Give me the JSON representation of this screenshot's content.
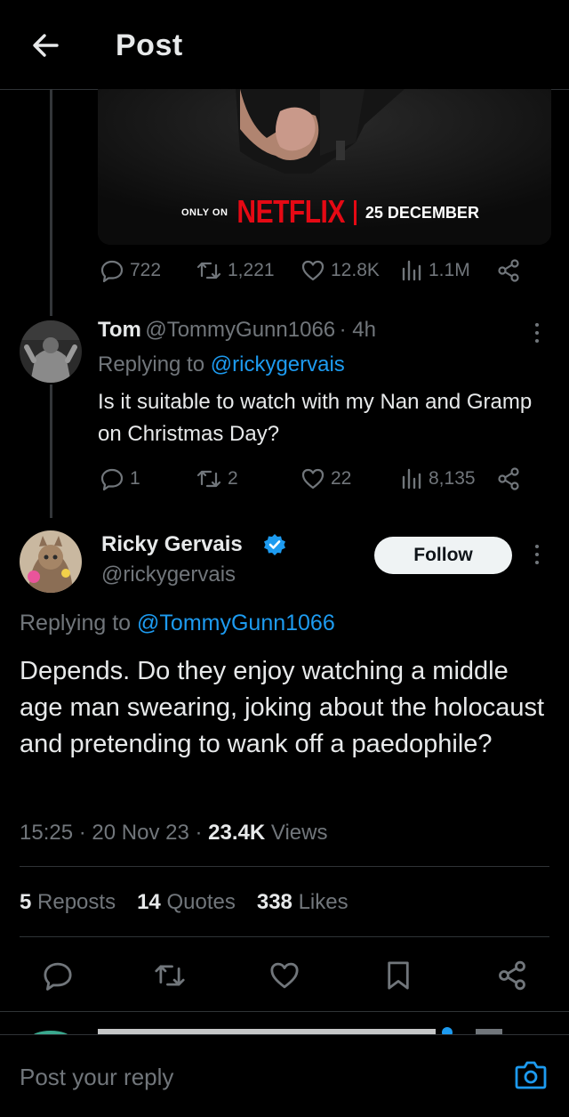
{
  "header": {
    "title": "Post"
  },
  "media": {
    "only_on": "ONLY ON",
    "brand": "NETFLIX",
    "date": "25 DECEMBER"
  },
  "original_post_actions": {
    "replies": "722",
    "reposts": "1,221",
    "likes": "12.8K",
    "views": "1.1M"
  },
  "reply_tom": {
    "name": "Tom",
    "handle": "@TommyGunn1066",
    "time": "· 4h",
    "replying_prefix": "Replying to",
    "replying_to": "@rickygervais",
    "text": "Is it suitable to watch with my Nan and Gramp on Christmas Day?",
    "actions": {
      "replies": "1",
      "reposts": "2",
      "likes": "22",
      "views": "8,135"
    }
  },
  "main_post": {
    "name": "Ricky Gervais",
    "handle": "@rickygervais",
    "follow_label": "Follow",
    "replying_prefix": "Replying to",
    "replying_to": "@TommyGunn1066",
    "text": "Depends. Do they enjoy watching a middle age man swearing, joking about the holocaust and pretending to wank off a paedophile?",
    "time": "15:25",
    "date": "20 Nov 23",
    "views_count": "23.4K",
    "views_label": "Views",
    "stats": {
      "reposts_count": "5",
      "reposts_label": "Reposts",
      "quotes_count": "14",
      "quotes_label": "Quotes",
      "likes_count": "338",
      "likes_label": "Likes"
    }
  },
  "reply_bar": {
    "placeholder": "Post your reply"
  },
  "colors": {
    "accent": "#1d9bf0",
    "netflix": "#e50914",
    "background": "#000000"
  }
}
